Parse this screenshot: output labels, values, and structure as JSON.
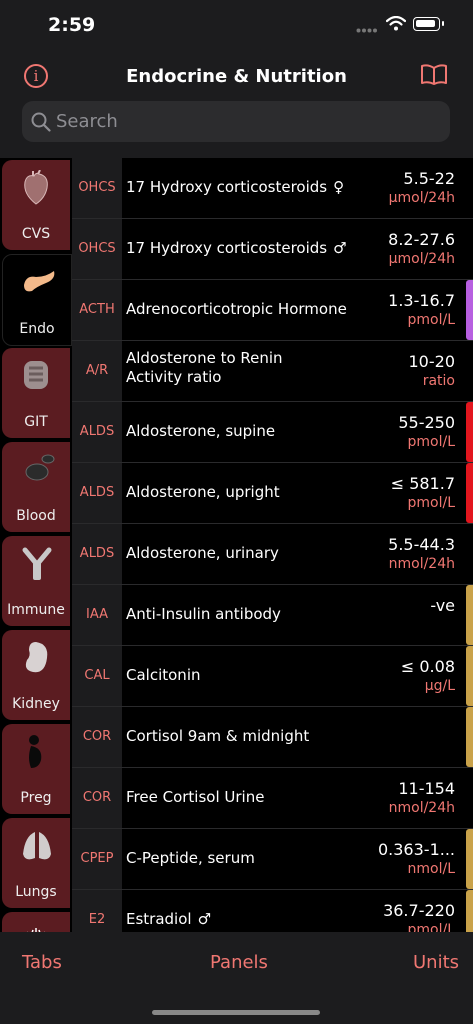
{
  "status": {
    "time": "2:59"
  },
  "nav": {
    "title": "Endocrine & Nutrition",
    "info_icon": "info-circle-icon",
    "book_icon": "book-icon"
  },
  "search": {
    "placeholder": "Search"
  },
  "sidebar": {
    "tabs": [
      {
        "label": "CVS",
        "icon": "heart-icon",
        "active": false
      },
      {
        "label": "Endo",
        "icon": "pancreas-icon",
        "active": true
      },
      {
        "label": "GIT",
        "icon": "intestine-icon",
        "active": false
      },
      {
        "label": "Blood",
        "icon": "blood-cells-icon",
        "active": false
      },
      {
        "label": "Immune",
        "icon": "antibody-icon",
        "active": false
      },
      {
        "label": "Kidney",
        "icon": "kidney-icon",
        "active": false
      },
      {
        "label": "Preg",
        "icon": "pregnancy-icon",
        "active": false
      },
      {
        "label": "Lungs",
        "icon": "lungs-icon",
        "active": false
      }
    ]
  },
  "rows": [
    {
      "abbr": "OHCS",
      "name": "17 Hydroxy corticosteroids",
      "symbol": "♀",
      "value": "5.5-22",
      "unit": "µmol/24h",
      "color": ""
    },
    {
      "abbr": "OHCS",
      "name": "17 Hydroxy corticosteroids",
      "symbol": "♂",
      "value": "8.2-27.6",
      "unit": "µmol/24h",
      "color": ""
    },
    {
      "abbr": "ACTH",
      "name": "Adrenocorticotropic Hormone",
      "symbol": "",
      "value": "1.3-16.7",
      "unit": "pmol/L",
      "color": "#b75fe0"
    },
    {
      "abbr": "A/R",
      "name": "Aldosterone to Renin Activity ratio",
      "symbol": "",
      "value": "10-20",
      "unit": "ratio",
      "color": ""
    },
    {
      "abbr": "ALDS",
      "name": "Aldosterone, supine",
      "symbol": "",
      "value": "55-250",
      "unit": "pmol/L",
      "color": "#e2161e"
    },
    {
      "abbr": "ALDS",
      "name": "Aldosterone, upright",
      "symbol": "",
      "value": "≤ 581.7",
      "unit": "pmol/L",
      "color": "#e2161e"
    },
    {
      "abbr": "ALDS",
      "name": "Aldosterone, urinary",
      "symbol": "",
      "value": "5.5-44.3",
      "unit": "nmol/24h",
      "color": ""
    },
    {
      "abbr": "IAA",
      "name": "Anti-Insulin antibody",
      "symbol": "",
      "value": "-ve",
      "unit": "",
      "color": "#c9a24a"
    },
    {
      "abbr": "CAL",
      "name": "Calcitonin",
      "symbol": "",
      "value": "≤ 0.08",
      "unit": "µg/L",
      "color": "#c9a24a"
    },
    {
      "abbr": "COR",
      "name": "Cortisol 9am & midnight",
      "symbol": "",
      "value": "",
      "unit": "",
      "color": "#c9a24a"
    },
    {
      "abbr": "COR",
      "name": "Free Cortisol Urine",
      "symbol": "",
      "value": "11-154",
      "unit": "nmol/24h",
      "color": ""
    },
    {
      "abbr": "CPEP",
      "name": "C-Peptide, serum",
      "symbol": "",
      "value": "0.363-1...",
      "unit": "nmol/L",
      "color": "#c9a24a"
    },
    {
      "abbr": "E2",
      "name": "Estradiol",
      "symbol": "♂",
      "value": "36.7-220",
      "unit": "pmol/L",
      "color": "#c9a24a"
    }
  ],
  "bottom": {
    "tabs_label": "Tabs",
    "panels_label": "Panels",
    "units_label": "Units"
  }
}
